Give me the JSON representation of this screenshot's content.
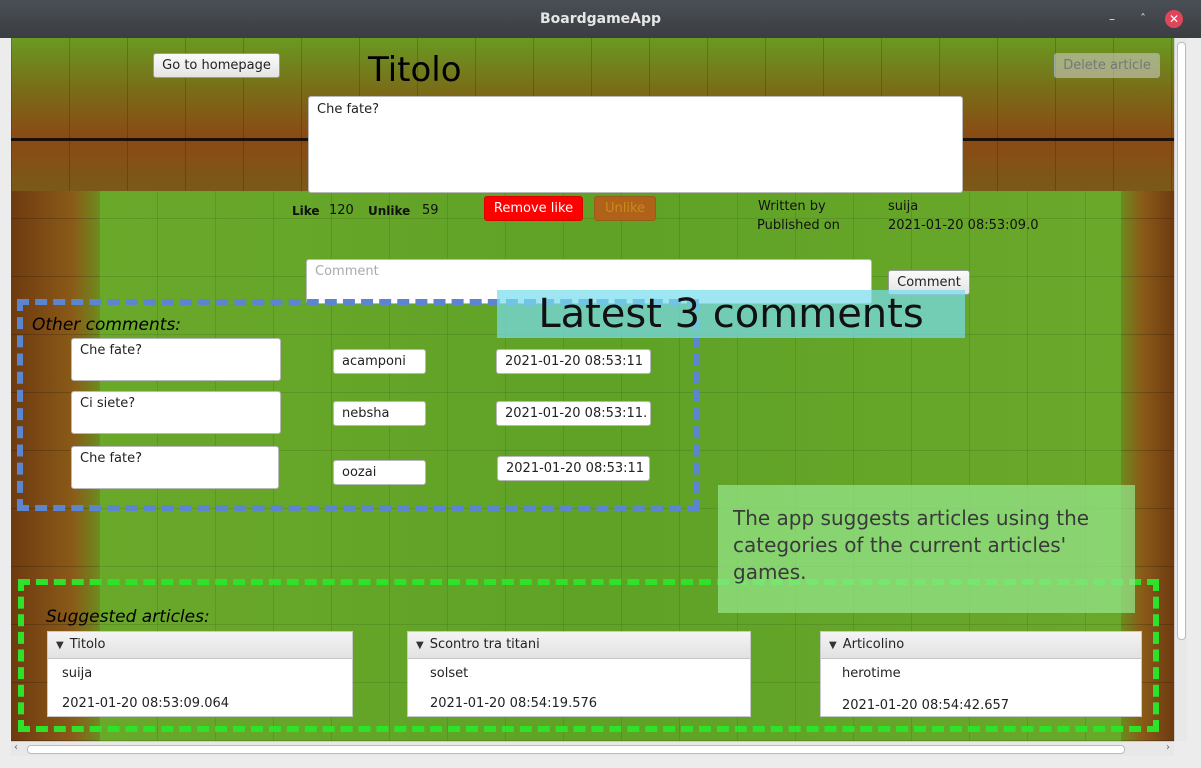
{
  "window": {
    "title": "BoardgameApp",
    "minimize": "–",
    "maximize": "ˆ",
    "close": "✕"
  },
  "header": {
    "home_button": "Go to homepage",
    "article_title": "Titolo",
    "delete_button": "Delete article"
  },
  "article": {
    "body": "Che fate?",
    "like_label": "Like",
    "like_count": "120",
    "unlike_label": "Unlike",
    "unlike_count": "59",
    "remove_like_button": "Remove like",
    "unlike_button": "Unlike",
    "written_by_label": "Written by",
    "author": "suija",
    "published_on_label": "Published on",
    "published_date": "2021-01-20 08:53:09.0"
  },
  "comment_form": {
    "placeholder": "Comment",
    "submit_button": "Comment"
  },
  "other_comments": {
    "label": "Other comments:",
    "items": [
      {
        "text": "Che fate?",
        "author": "acamponi",
        "date": "2021-01-20 08:53:11"
      },
      {
        "text": "Ci siete?",
        "author": "nebsha",
        "date": "2021-01-20 08:53:11."
      },
      {
        "text": "Che fate?",
        "author": "oozai",
        "date": "2021-01-20 08:53:11"
      }
    ]
  },
  "annotations": {
    "latest_comments": "Latest 3 comments",
    "suggestion_note": "The app suggests articles using the categories of the current articles' games."
  },
  "suggested": {
    "label": "Suggested articles:",
    "items": [
      {
        "title": "Titolo",
        "author": "suija",
        "date": "2021-01-20 08:53:09.064"
      },
      {
        "title": "Scontro tra titani",
        "author": "solset",
        "date": "2021-01-20 08:54:19.576"
      },
      {
        "title": "Articolino",
        "author": "herotime",
        "date": "2021-01-20 08:54:42.657"
      }
    ]
  },
  "colors": {
    "remove_like": "#ff0000",
    "unlike_button": "#b0621a",
    "blue_dash": "#5b86cf",
    "green_dash": "#2ee22a"
  }
}
